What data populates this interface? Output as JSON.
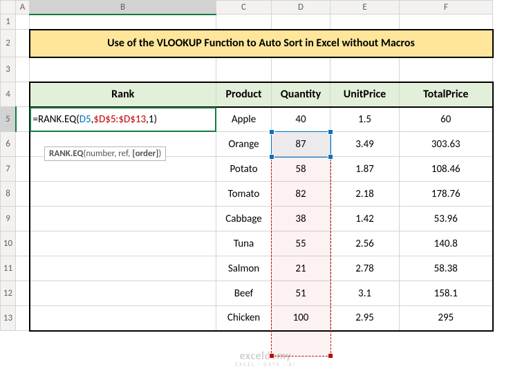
{
  "columns": [
    "A",
    "B",
    "C",
    "D",
    "E",
    "F"
  ],
  "col_widths": {
    "rowhdr": 22,
    "A": 20,
    "B": 270,
    "C": 80,
    "D": 85,
    "E": 100,
    "F": 135
  },
  "rows": [
    "1",
    "2",
    "3",
    "4",
    "5",
    "6",
    "7",
    "8",
    "9",
    "10",
    "11",
    "12",
    "13"
  ],
  "row_heights": {
    "colhdr": 20,
    "1": 22,
    "2": 40,
    "default": 36
  },
  "active_cell": "B5",
  "selected_column": "B",
  "selected_row": "5",
  "title": "Use of the VLOOKUP Function to Auto Sort in Excel without Macros",
  "headers": {
    "B": "Rank",
    "C": "Product",
    "D": "Quantity",
    "E": "UnitPrice",
    "F": "TotalPrice"
  },
  "formula": {
    "prefix": "=RANK.EQ(",
    "arg1": "D5",
    "sep1": ",",
    "arg2": "$D$5:$D$13",
    "sep2": ",",
    "arg3": "1",
    "suffix": ")"
  },
  "tooltip": {
    "fn": "RANK.EQ",
    "sig": "(number, ref, ",
    "opt": "[order]",
    "close": ")"
  },
  "referenced_range": "D5:D13",
  "referenced_cell": "D5",
  "chart_data": {
    "type": "table",
    "columns": [
      "Product",
      "Quantity",
      "UnitPrice",
      "TotalPrice"
    ],
    "rows": [
      {
        "Product": "Apple",
        "Quantity": 40,
        "UnitPrice": 1.5,
        "TotalPrice": 60
      },
      {
        "Product": "Orange",
        "Quantity": 87,
        "UnitPrice": 3.49,
        "TotalPrice": 303.63
      },
      {
        "Product": "Potato",
        "Quantity": 58,
        "UnitPrice": 1.87,
        "TotalPrice": 108.46
      },
      {
        "Product": "Tomato",
        "Quantity": 82,
        "UnitPrice": 2.18,
        "TotalPrice": 178.76
      },
      {
        "Product": "Cabbage",
        "Quantity": 38,
        "UnitPrice": 1.42,
        "TotalPrice": 53.96
      },
      {
        "Product": "Tuna",
        "Quantity": 55,
        "UnitPrice": 2.56,
        "TotalPrice": 140.8
      },
      {
        "Product": "Salmon",
        "Quantity": 21,
        "UnitPrice": 2.78,
        "TotalPrice": 58.38
      },
      {
        "Product": "Beef",
        "Quantity": 51,
        "UnitPrice": 3.1,
        "TotalPrice": 158.1
      },
      {
        "Product": "Chicken",
        "Quantity": 100,
        "UnitPrice": 2.95,
        "TotalPrice": 295
      }
    ]
  },
  "watermark": {
    "main": "exceldemy",
    "sub": "EXCEL · DATA · BI"
  }
}
